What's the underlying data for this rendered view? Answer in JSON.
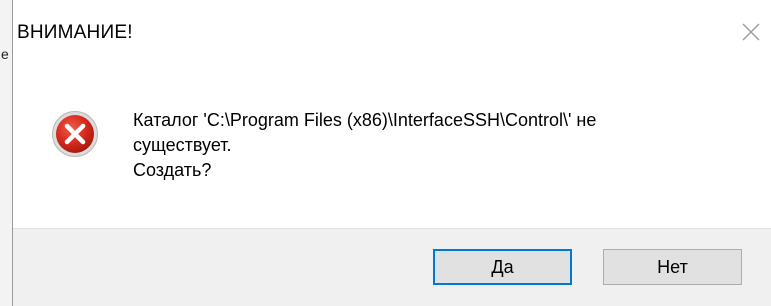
{
  "background": {
    "fragment_char": "е"
  },
  "dialog": {
    "title": "ВНИМАНИЕ!",
    "icon": "error-icon",
    "message_lines": [
      "Каталог 'C:\\Program Files (x86)\\InterfaceSSH\\Control\\' не",
      "существует.",
      "Создать?"
    ],
    "buttons": {
      "yes_label": "Да",
      "no_label": "Нет"
    }
  },
  "colors": {
    "error_red": "#c42b1c",
    "focus_blue": "#0078d7",
    "footer_bg": "#f0f0f0",
    "button_bg": "#e1e1e1"
  }
}
